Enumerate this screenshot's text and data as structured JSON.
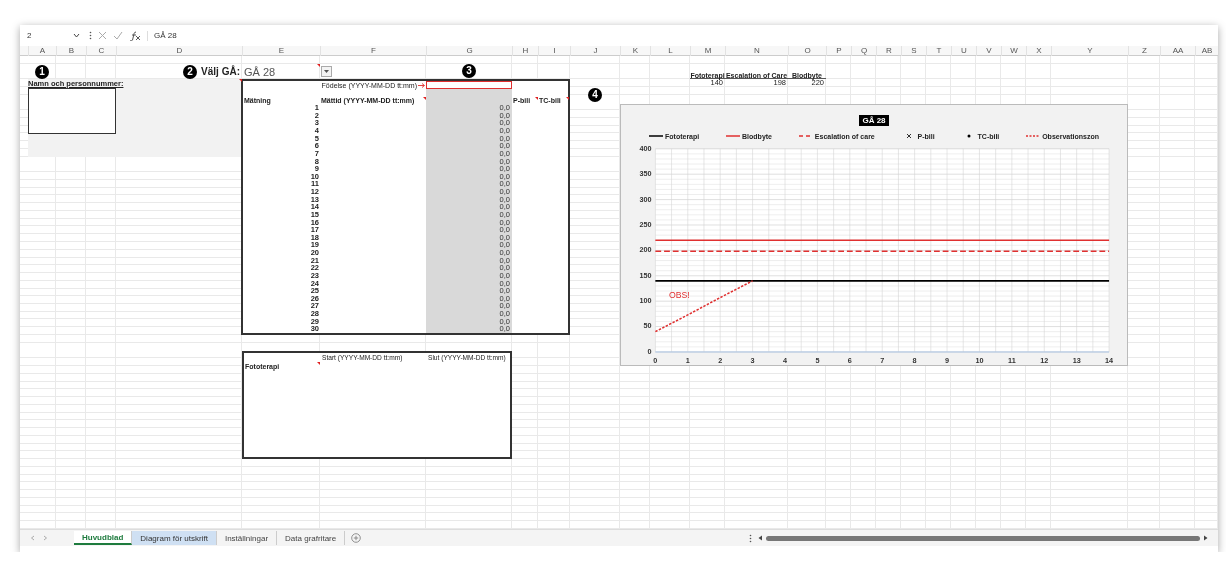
{
  "formula_bar": {
    "name_box": "2",
    "formula": "GÅ 28"
  },
  "columns": [
    "A",
    "B",
    "C",
    "D",
    "E",
    "F",
    "G",
    "H",
    "I",
    "J",
    "K",
    "L",
    "M",
    "N",
    "O",
    "P",
    "Q",
    "R",
    "S",
    "T",
    "U",
    "V",
    "W",
    "X",
    "Y",
    "Z",
    "AA",
    "AB"
  ],
  "markers": [
    "1",
    "2",
    "3",
    "4"
  ],
  "name_section": {
    "label": "Namn och personnummer:",
    "has_comment": true
  },
  "ga_select": {
    "label": "Välj GÅ:",
    "value": "GÅ 28",
    "has_comment": true
  },
  "thresholds": {
    "headers": [
      "Fototerapi",
      "Escalation of Care",
      "Blodbyte"
    ],
    "values": [
      "140",
      "198",
      "220"
    ]
  },
  "measurements": {
    "birth_label": "Födelse (YYYY-MM-DD tt:mm)",
    "columns": [
      {
        "label": "Mätning"
      },
      {
        "label": "Mättid (YYYY-MM-DD tt:mm)",
        "has_comment": true
      },
      {
        "label": "P-bili",
        "has_comment": true
      },
      {
        "label": "TC-bili",
        "has_comment": true
      }
    ],
    "rows": [
      {
        "number": "1",
        "value": "0,0"
      },
      {
        "number": "2",
        "value": "0,0"
      },
      {
        "number": "3",
        "value": "0,0"
      },
      {
        "number": "4",
        "value": "0,0"
      },
      {
        "number": "5",
        "value": "0,0"
      },
      {
        "number": "6",
        "value": "0,0"
      },
      {
        "number": "7",
        "value": "0,0"
      },
      {
        "number": "8",
        "value": "0,0"
      },
      {
        "number": "9",
        "value": "0,0"
      },
      {
        "number": "10",
        "value": "0,0"
      },
      {
        "number": "11",
        "value": "0,0"
      },
      {
        "number": "12",
        "value": "0,0"
      },
      {
        "number": "13",
        "value": "0,0"
      },
      {
        "number": "14",
        "value": "0,0"
      },
      {
        "number": "15",
        "value": "0,0"
      },
      {
        "number": "16",
        "value": "0,0"
      },
      {
        "number": "17",
        "value": "0,0"
      },
      {
        "number": "18",
        "value": "0,0"
      },
      {
        "number": "19",
        "value": "0,0"
      },
      {
        "number": "20",
        "value": "0,0"
      },
      {
        "number": "21",
        "value": "0,0"
      },
      {
        "number": "22",
        "value": "0,0"
      },
      {
        "number": "23",
        "value": "0,0"
      },
      {
        "number": "24",
        "value": "0,0"
      },
      {
        "number": "25",
        "value": "0,0"
      },
      {
        "number": "26",
        "value": "0,0"
      },
      {
        "number": "27",
        "value": "0,0"
      },
      {
        "number": "28",
        "value": "0,0"
      },
      {
        "number": "29",
        "value": "0,0"
      },
      {
        "number": "30",
        "value": "0,0"
      }
    ]
  },
  "phototherapy": {
    "label": "Fototerapi",
    "has_comment": true,
    "start_label": "Start (YYYY-MM-DD tt:mm)",
    "end_label": "Slut (YYYY-MM-DD tt:mm)"
  },
  "chart": {
    "chart_data": {
      "type": "line",
      "title": "GÅ 28",
      "x": [
        0,
        1,
        2,
        3,
        4,
        5,
        6,
        7,
        8,
        9,
        10,
        11,
        12,
        13,
        14
      ],
      "xlim": [
        0,
        14
      ],
      "ylim": [
        0,
        400
      ],
      "xticks": [
        0,
        1,
        2,
        3,
        4,
        5,
        6,
        7,
        8,
        9,
        10,
        11,
        12,
        13,
        14
      ],
      "yticks": [
        0,
        50,
        100,
        150,
        200,
        250,
        300,
        350,
        400
      ],
      "grid": true,
      "legend": "top",
      "series": [
        {
          "name": "Fototerapi",
          "color": "#000000",
          "line_style": "solid",
          "values": [
            140,
            140,
            140,
            140,
            140,
            140,
            140,
            140,
            140,
            140,
            140,
            140,
            140,
            140,
            140
          ]
        },
        {
          "name": "Blodbyte",
          "color": "#e03030",
          "line_style": "solid",
          "values": [
            220,
            220,
            220,
            220,
            220,
            220,
            220,
            220,
            220,
            220,
            220,
            220,
            220,
            220,
            220
          ]
        },
        {
          "name": "Escalation of care",
          "color": "#e03030",
          "line_style": "dashed",
          "values": [
            198,
            198,
            198,
            198,
            198,
            198,
            198,
            198,
            198,
            198,
            198,
            198,
            198,
            198,
            198
          ]
        },
        {
          "name": "P-bili",
          "color": "#000000",
          "marker": "x",
          "values": [
            null,
            null,
            null,
            null,
            null,
            null,
            null,
            null,
            null,
            null,
            null,
            null,
            null,
            null,
            null
          ]
        },
        {
          "name": "TC-bili",
          "color": "#000000",
          "marker": "dot",
          "values": [
            null,
            null,
            null,
            null,
            null,
            null,
            null,
            null,
            null,
            null,
            null,
            null,
            null,
            null,
            null
          ]
        },
        {
          "name": "Observationszon",
          "color": "#e03030",
          "line_style": "dotted",
          "values": [
            40,
            73,
            107,
            140,
            null,
            null,
            null,
            null,
            null,
            null,
            null,
            null,
            null,
            null,
            null
          ]
        }
      ],
      "annotations": [
        "OBS!"
      ]
    }
  },
  "sheet_tabs": [
    {
      "label": "Huvudblad",
      "selected": true,
      "highlighted": false
    },
    {
      "label": "Diagram för utskrift",
      "selected": false,
      "highlighted": true
    },
    {
      "label": "Inställningar",
      "selected": false,
      "highlighted": false
    },
    {
      "label": "Data grafritare",
      "selected": false,
      "highlighted": false
    }
  ]
}
